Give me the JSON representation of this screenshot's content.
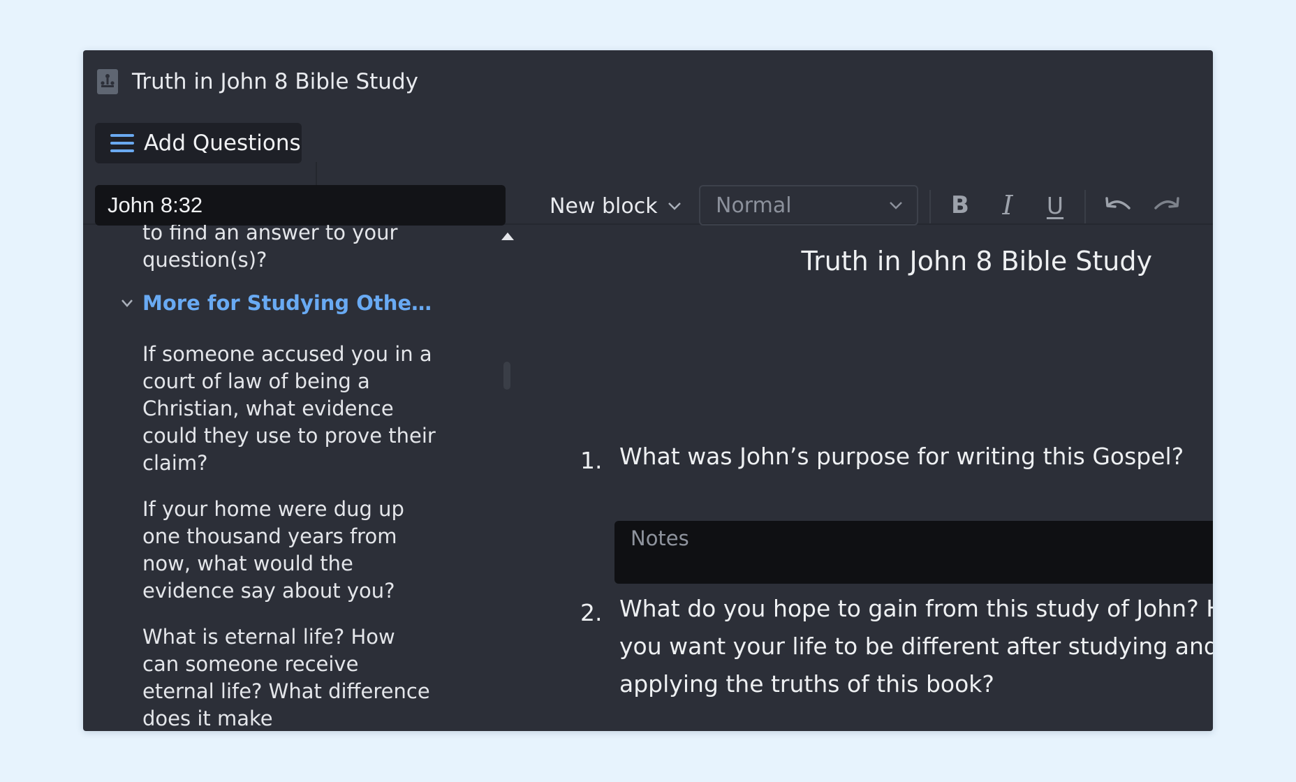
{
  "window": {
    "title": "Truth in John 8 Bible Study"
  },
  "toolbar": {
    "add_questions_label": "Add Questions"
  },
  "search": {
    "value": "John 8:32"
  },
  "editor_toolbar": {
    "block_label": "New block",
    "style_label": "Normal",
    "bold": "B",
    "italic": "I",
    "underline": "U"
  },
  "sidebar": {
    "top_partial": "to find an answer to your question(s)?",
    "section": "More for Studying Other Th…",
    "items": [
      "If someone accused you in a court of law of being a Christian, what evidence could they use to prove their claim?",
      "If your home were dug up one thousand years from now, what would the evidence say about you?",
      "What is eternal life? How can someone receive eternal life? What difference does it make"
    ]
  },
  "document": {
    "title": "Truth in John 8 Bible Study",
    "questions": [
      {
        "number": "1.",
        "text": "What was John’s purpose for writing this Gospel?",
        "notes_placeholder": "Notes"
      },
      {
        "number": "2.",
        "text": "What do you hope to gain from this study of John? How do you want your life to be different after studying and applying the truths of this book?"
      }
    ]
  }
}
